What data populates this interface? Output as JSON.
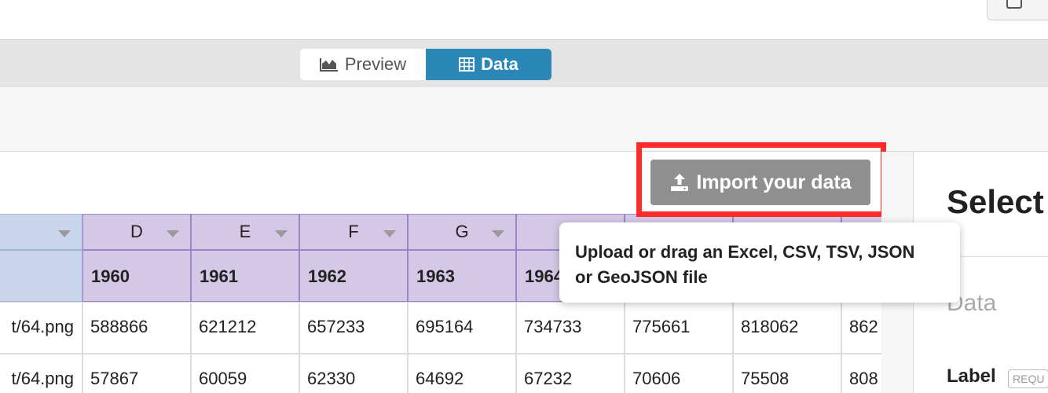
{
  "view_toggle": {
    "preview_label": "Preview",
    "data_label": "Data"
  },
  "import_button": {
    "label": "Import your data"
  },
  "tooltip": {
    "line1": "Upload or drag an Excel, CSV, TSV, JSON",
    "line2": "or GeoJSON file"
  },
  "sheet": {
    "column_letters": [
      "",
      "D",
      "E",
      "F",
      "G",
      "",
      "",
      "",
      ""
    ],
    "header_row": [
      "",
      "1960",
      "1961",
      "1962",
      "1963",
      "1964",
      "",
      "",
      ""
    ],
    "rows": [
      [
        "t/64.png",
        "588866",
        "621212",
        "657233",
        "695164",
        "734733",
        "775661",
        "818062",
        "862"
      ],
      [
        "t/64.png",
        "57867",
        "60059",
        "62330",
        "64692",
        "67232",
        "70606",
        "75508",
        "808"
      ]
    ]
  },
  "right_panel": {
    "title": "Select",
    "data_label": "Data",
    "label_heading": "Label",
    "required_badge": "REQU"
  },
  "colors": {
    "accent": "#2a87b8",
    "highlight": "#ff2a2a",
    "button_gray": "#8f8f8f",
    "column_purple": "#d4c8e6"
  }
}
